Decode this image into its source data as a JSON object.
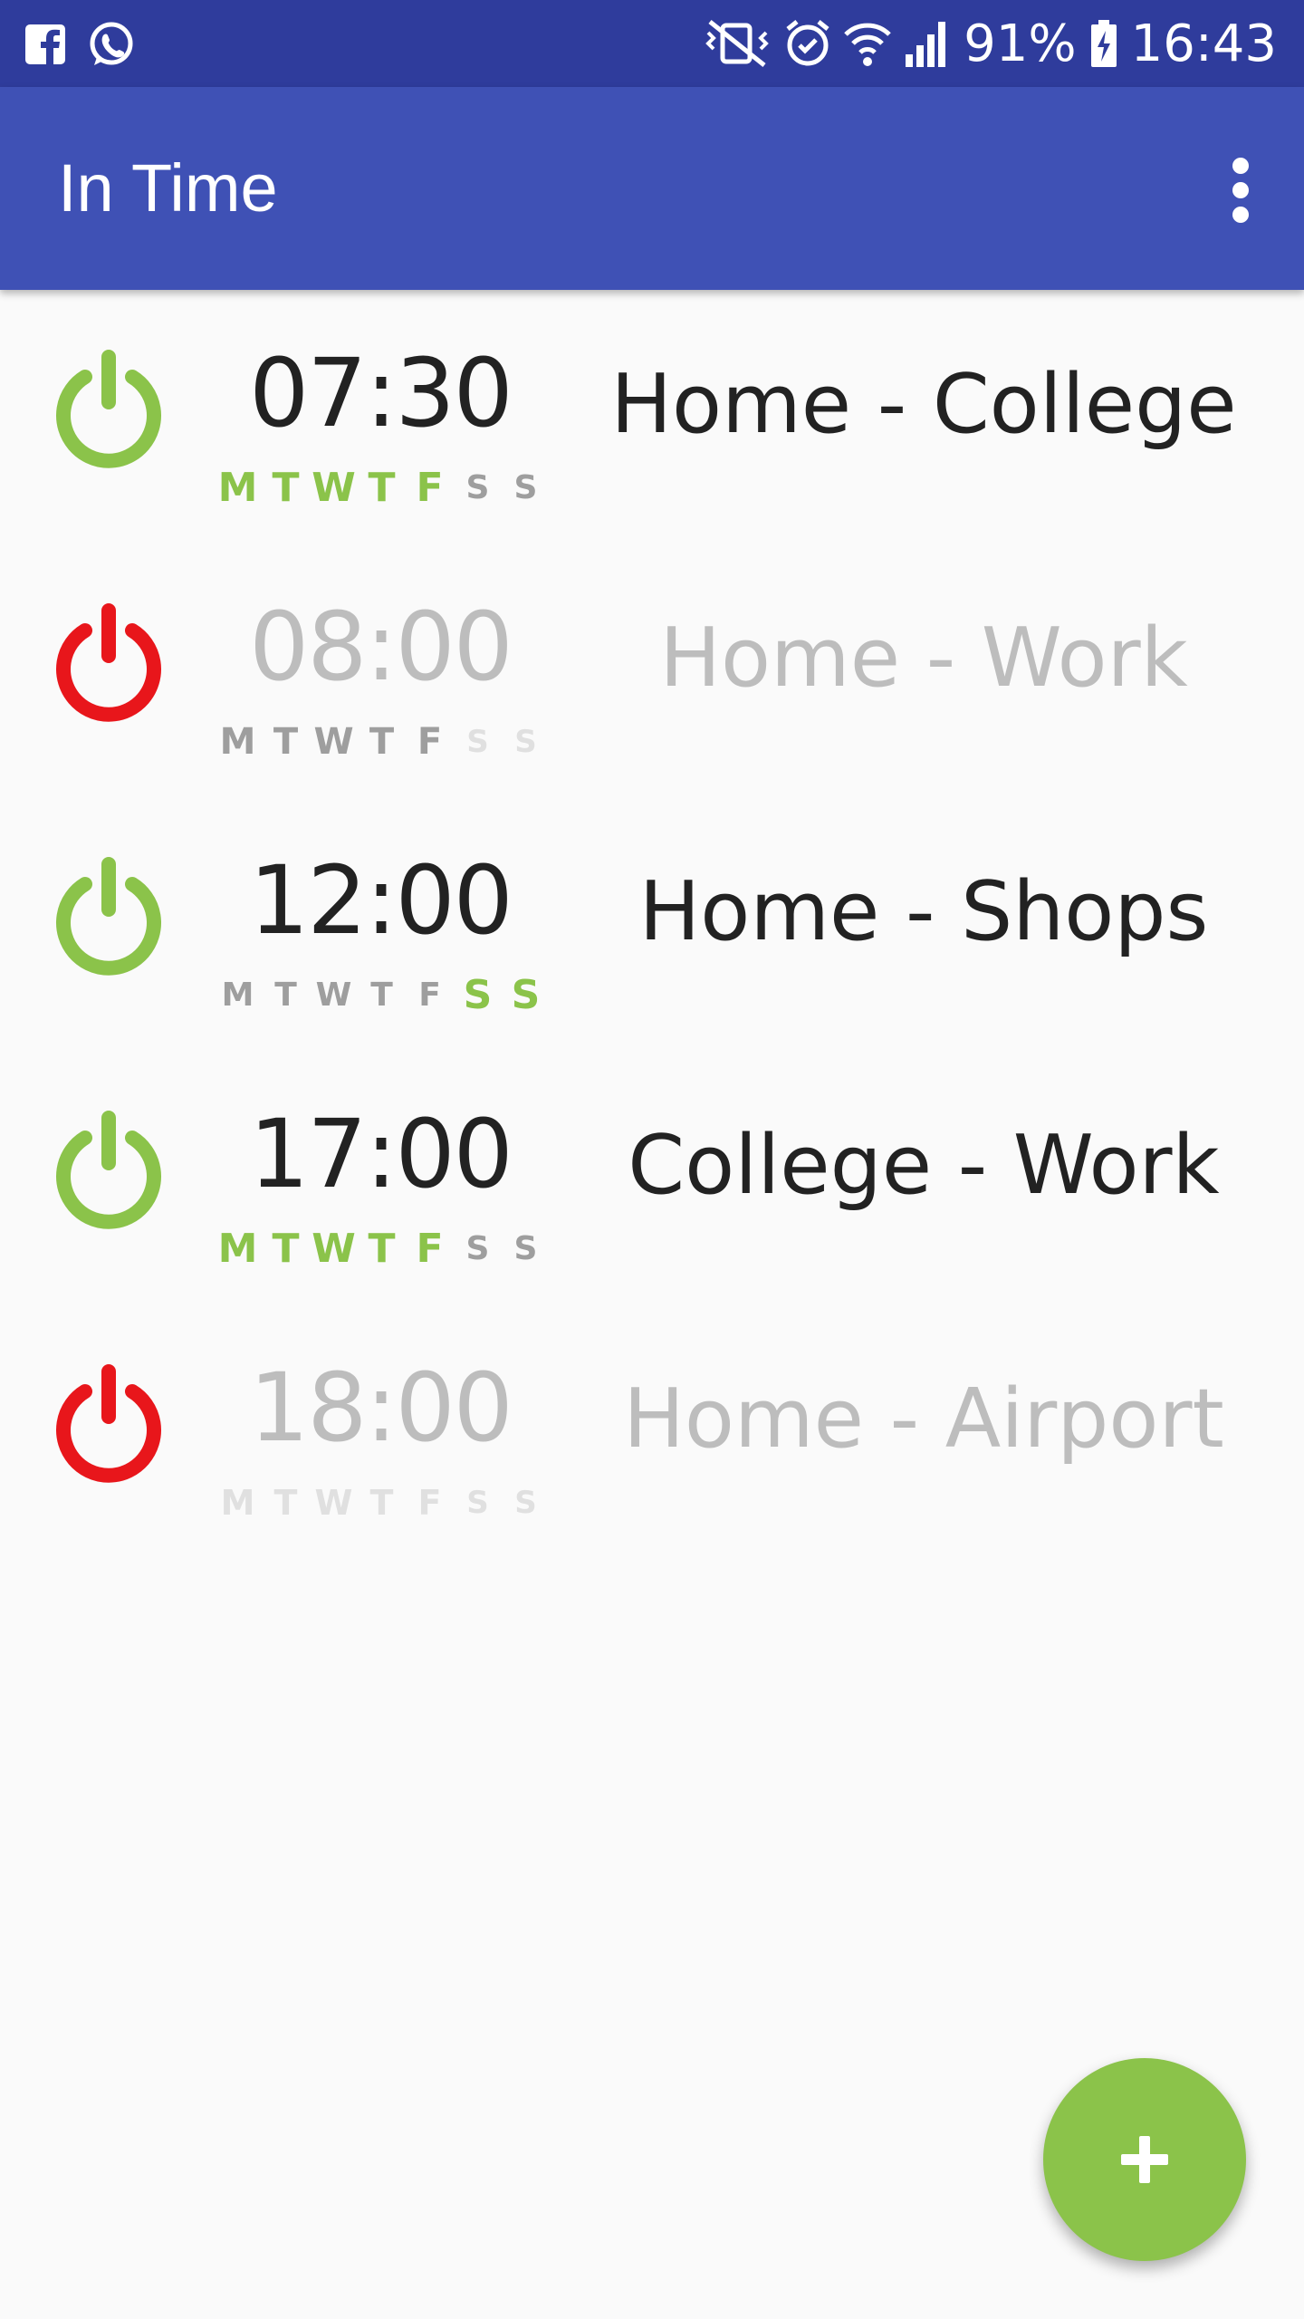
{
  "status_bar": {
    "left_icons": [
      "facebook-icon",
      "whatsapp-icon"
    ],
    "right_icons": [
      "vibrate-mute-icon",
      "alarm-icon",
      "wifi-icon",
      "signal-icon"
    ],
    "battery": "91%",
    "time": "16:43"
  },
  "app_bar": {
    "title": "In Time",
    "menu_icon": "more-vert-icon"
  },
  "colors": {
    "status_bar": "#2f3c9c",
    "app_bar": "#3f51b5",
    "active_green": "#8bc34a",
    "inactive_red": "#e8161b",
    "day_off_active": "#9e9e9e",
    "day_on_inactive": "#9e9e9e",
    "day_off_inactive": "#e0e0e0"
  },
  "alarms": [
    {
      "enabled": true,
      "time": "07:30",
      "route": "Home - College",
      "days": [
        {
          "label": "M",
          "on": true
        },
        {
          "label": "T",
          "on": true
        },
        {
          "label": "W",
          "on": true
        },
        {
          "label": "T",
          "on": true
        },
        {
          "label": "F",
          "on": true
        },
        {
          "label": "S",
          "on": false
        },
        {
          "label": "S",
          "on": false
        }
      ]
    },
    {
      "enabled": false,
      "time": "08:00",
      "route": "Home - Work",
      "days": [
        {
          "label": "M",
          "on": true
        },
        {
          "label": "T",
          "on": true
        },
        {
          "label": "W",
          "on": true
        },
        {
          "label": "T",
          "on": true
        },
        {
          "label": "F",
          "on": true
        },
        {
          "label": "S",
          "on": false
        },
        {
          "label": "S",
          "on": false
        }
      ]
    },
    {
      "enabled": true,
      "time": "12:00",
      "route": "Home - Shops",
      "days": [
        {
          "label": "M",
          "on": false
        },
        {
          "label": "T",
          "on": false
        },
        {
          "label": "W",
          "on": false
        },
        {
          "label": "T",
          "on": false
        },
        {
          "label": "F",
          "on": false
        },
        {
          "label": "S",
          "on": true
        },
        {
          "label": "S",
          "on": true
        }
      ]
    },
    {
      "enabled": true,
      "time": "17:00",
      "route": "College - Work",
      "days": [
        {
          "label": "M",
          "on": true
        },
        {
          "label": "T",
          "on": true
        },
        {
          "label": "W",
          "on": true
        },
        {
          "label": "T",
          "on": true
        },
        {
          "label": "F",
          "on": true
        },
        {
          "label": "S",
          "on": false
        },
        {
          "label": "S",
          "on": false
        }
      ]
    },
    {
      "enabled": false,
      "time": "18:00",
      "route": "Home - Airport",
      "days": [
        {
          "label": "M",
          "on": false
        },
        {
          "label": "T",
          "on": false
        },
        {
          "label": "W",
          "on": false
        },
        {
          "label": "T",
          "on": false
        },
        {
          "label": "F",
          "on": false
        },
        {
          "label": "S",
          "on": false
        },
        {
          "label": "S",
          "on": false
        }
      ]
    }
  ],
  "fab": {
    "icon": "plus-icon"
  }
}
